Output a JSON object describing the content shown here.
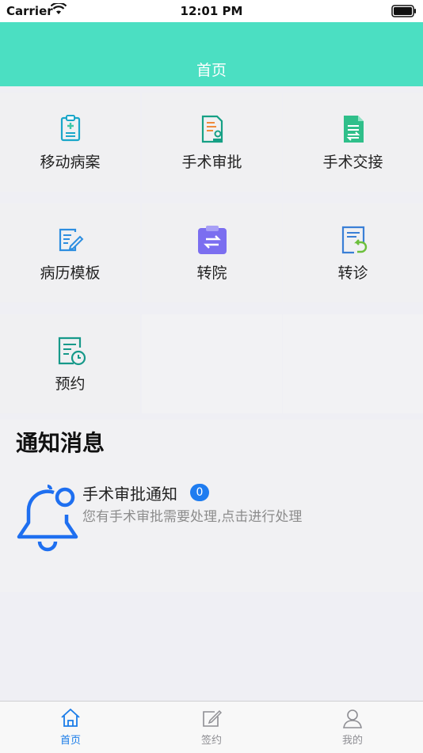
{
  "status_bar": {
    "carrier": "Carrier",
    "time": "12:01 PM"
  },
  "nav": {
    "title": "首页"
  },
  "grid": {
    "items": [
      {
        "label": "移动病案",
        "icon": "clipboard-medical-icon",
        "color": "#1aa7c9"
      },
      {
        "label": "手术审批",
        "icon": "document-approval-icon",
        "color": "#16a085"
      },
      {
        "label": "手术交接",
        "icon": "document-transfer-icon",
        "color": "#2fbf8a"
      },
      {
        "label": "病历模板",
        "icon": "edit-document-icon",
        "color": "#2d8ee0"
      },
      {
        "label": "转院",
        "icon": "transfer-clipboard-icon",
        "color": "#7b6ef0"
      },
      {
        "label": "转诊",
        "icon": "referral-document-icon",
        "color": "#3a7fd6"
      },
      {
        "label": "预约",
        "icon": "appointment-clock-icon",
        "color": "#17998a"
      }
    ]
  },
  "notices": {
    "heading": "通知消息",
    "items": [
      {
        "title": "手术审批通知",
        "badge": "0",
        "desc": "您有手术审批需要处理,点击进行处理"
      }
    ]
  },
  "tabs": [
    {
      "label": "首页",
      "icon": "home-icon",
      "active": true
    },
    {
      "label": "签约",
      "icon": "sign-edit-icon",
      "active": false
    },
    {
      "label": "我的",
      "icon": "user-icon",
      "active": false
    }
  ],
  "colors": {
    "accent": "#4bdfc2",
    "tab_active": "#1a7ce8",
    "badge": "#1e7cf0"
  }
}
